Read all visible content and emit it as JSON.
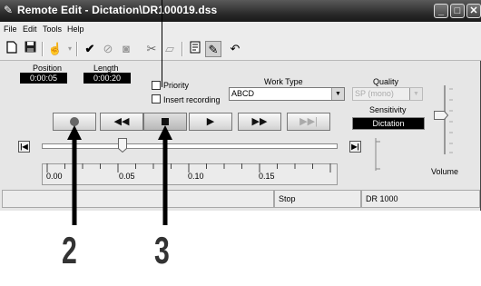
{
  "window": {
    "title": "Remote Edit - Dictation\\DR100019.dss",
    "minimize_icon": "minimize-icon",
    "maximize_icon": "maximize-icon",
    "close_icon": "close-icon"
  },
  "menu": [
    "File",
    "Edit",
    "Tools",
    "Help"
  ],
  "toolbar": {
    "icons": [
      "new-file-icon",
      "save-icon",
      "hand-icon",
      "checkmark-icon",
      "cancel-icon",
      "disk-icon",
      "cut-icon",
      "folder-icon",
      "properties-icon",
      "pen-icon",
      "undo-icon"
    ]
  },
  "position": {
    "label": "Position",
    "value": "0:00:05"
  },
  "length": {
    "label": "Length",
    "value": "0:00:20"
  },
  "priority": {
    "label": "Priority",
    "checked": false
  },
  "insert_recording": {
    "label": "Insert recording",
    "checked": false
  },
  "work_type": {
    "label": "Work Type",
    "value": "ABCD"
  },
  "quality": {
    "label": "Quality",
    "value": "SP (mono)"
  },
  "sensitivity": {
    "label": "Sensitivity",
    "value": "Dictation"
  },
  "volume": {
    "label": "Volume",
    "level": 0.55
  },
  "transport": [
    "record-icon",
    "rewind-icon",
    "stop-icon",
    "play-icon",
    "fast-forward-icon",
    "skip-end-icon"
  ],
  "timeline": {
    "ticks": [
      "0.00",
      "0.05",
      "0.10",
      "0.15"
    ],
    "position_fraction": 0.25
  },
  "statusbar": {
    "state": "Stop",
    "device": "DR 1000"
  },
  "callouts": [
    "2",
    "3"
  ]
}
